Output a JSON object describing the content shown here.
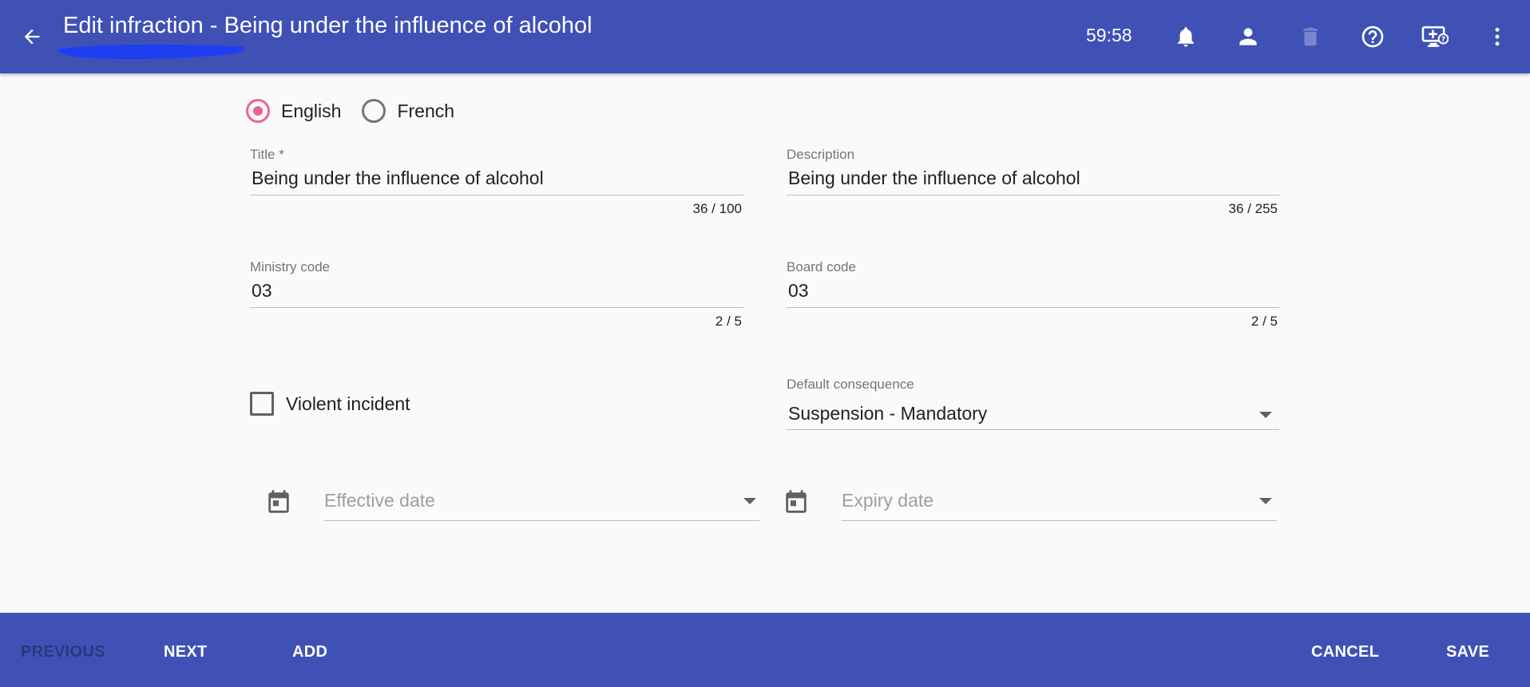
{
  "header": {
    "title": "Edit infraction - Being under the influence of alcohol",
    "timer": "59:58",
    "icons": [
      "back-arrow-icon",
      "bell-icon",
      "person-icon",
      "trash-icon",
      "help-icon",
      "monitor-help-icon",
      "more-vert-icon"
    ]
  },
  "language": {
    "options": [
      {
        "label": "English",
        "checked": true
      },
      {
        "label": "French",
        "checked": false
      }
    ]
  },
  "form": {
    "title": {
      "label": "Title *",
      "value": "Being under the influence of alcohol",
      "counter": "36 / 100"
    },
    "description": {
      "label": "Description",
      "value": "Being under the influence of alcohol",
      "counter": "36 / 255"
    },
    "ministry_code": {
      "label": "Ministry code",
      "value": "03",
      "counter": "2 / 5"
    },
    "board_code": {
      "label": "Board code",
      "value": "03",
      "counter": "2 / 5"
    },
    "violent_incident": {
      "label": "Violent incident",
      "checked": false
    },
    "default_consequence": {
      "label": "Default consequence",
      "value": "Suspension - Mandatory"
    },
    "effective_date": {
      "placeholder": "Effective date"
    },
    "expiry_date": {
      "placeholder": "Expiry date"
    }
  },
  "footer": {
    "previous": "PREVIOUS",
    "next": "NEXT",
    "add": "ADD",
    "cancel": "CANCEL",
    "save": "SAVE"
  },
  "colors": {
    "primary": "#3f51b5",
    "accent": "#f06292",
    "scribble": "#1e3ff0"
  }
}
